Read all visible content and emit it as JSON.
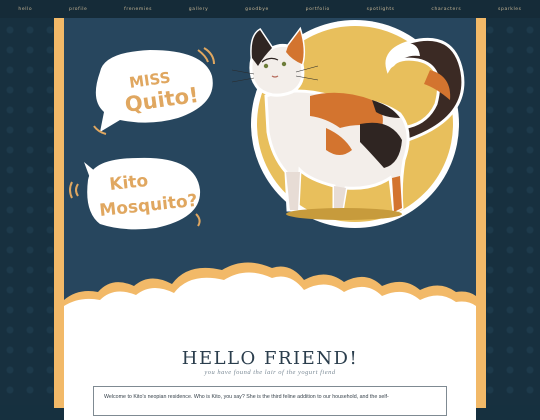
{
  "nav": {
    "items": [
      {
        "label": "hello"
      },
      {
        "label": "profile"
      },
      {
        "label": "frenemies"
      },
      {
        "label": "gallery"
      },
      {
        "label": "goodbye"
      },
      {
        "label": "portfolio"
      },
      {
        "label": "spotlights"
      },
      {
        "label": "characters"
      },
      {
        "label": "sparkles"
      }
    ]
  },
  "banner": {
    "bubble1": {
      "line1": "MISS",
      "line2": "Quito!"
    },
    "bubble2": {
      "line1": "Kito",
      "line2": "Mosquito?"
    }
  },
  "main": {
    "title": "HELLO FRIEND!",
    "subtitle": "you have found the lair of the yogurt fiend",
    "intro": "Welcome to Kito's neopian residence. Who is Kito, you say? She is the third feline addition to our household, and the self-"
  },
  "colors": {
    "background": "#16303f",
    "banner": "#27465e",
    "frame": "#f2b968",
    "bubble_text": "#e0a760",
    "sun": "#e8bf5c",
    "title": "#2a3d4c"
  }
}
